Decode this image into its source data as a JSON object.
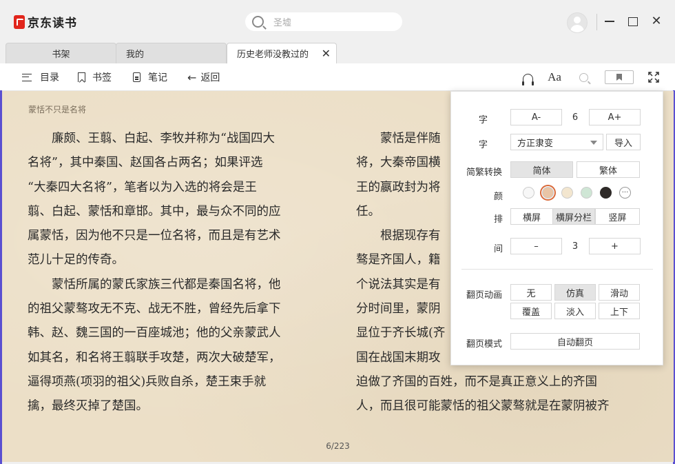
{
  "app": {
    "logo_text": "京东读书"
  },
  "search": {
    "placeholder": "圣墟"
  },
  "tabs": [
    {
      "label": "书架"
    },
    {
      "label": "我的"
    },
    {
      "label": "历史老师没教过的"
    }
  ],
  "toolbar": {
    "toc_label": "目录",
    "bookmark_label": "书签",
    "notes_label": "笔记",
    "back_label": "返回",
    "font_icon_text": "Aa"
  },
  "book": {
    "running_head": "蒙恬不只是名将",
    "left_column": [
      "　　廉颇、王翦、白起、李牧并称为“战国四大",
      "名将”，其中秦国、赵国各占两名；如果评选",
      "“大秦四大名将”，笔者以为入选的将会是王",
      "翦、白起、蒙恬和章邯。其中，最与众不同的应",
      "属蒙恬，因为他不只是一位名将，而且是有艺术",
      "范儿十足的传奇。",
      "　　蒙恬所属的蒙氏家族三代都是秦国名将，他",
      "的祖父蒙骜攻无不克、战无不胜，曾经先后拿下",
      "韩、赵、魏三国的一百座城池；他的父亲蒙武人",
      "如其名，和名将王翦联手攻楚，两次大破楚军，",
      "逼得项燕(项羽的祖父)兵败自杀，楚王束手就",
      "擒，最终灭掉了楚国。"
    ],
    "right_column": [
      "　　蒙恬是伴随",
      "将，大秦帝国横",
      "王的嬴政封为将",
      "任。",
      "　　根据现存有",
      "骜是齐国人，籍",
      "个说法其实是有",
      "分时间里，蒙阴",
      "显位于齐长城(齐",
      "国在战国末期攻",
      "迫做了齐国的百姓，而不是真正意义上的齐国",
      "人，而且很可能蒙恬的祖父蒙骜就是在蒙阴被齐"
    ],
    "page_indicator": "6/223"
  },
  "settings": {
    "font_size": {
      "label": "字",
      "decrease": "A-",
      "value": "6",
      "increase": "A+"
    },
    "font_face": {
      "label": "字",
      "selected": "方正隶变",
      "import_label": "导入"
    },
    "conversion": {
      "label": "简繁转换",
      "options": [
        "简体",
        "繁体"
      ],
      "selected": "简体"
    },
    "color": {
      "label": "颜",
      "swatches": [
        "#f7f7f7",
        "#e9c5a6",
        "#f3e6cf",
        "#cfe6d5",
        "#2e2a28"
      ],
      "selected_index": 1,
      "more_label": "···"
    },
    "layout": {
      "label": "排",
      "options": [
        "横屏",
        "横屏分栏",
        "竖屏"
      ],
      "selected": "横屏分栏"
    },
    "spacing": {
      "label": "间",
      "decrease": "–",
      "value": "3",
      "increase": "+"
    },
    "page_anim": {
      "label": "翻页动画",
      "options": [
        "无",
        "仿真",
        "滑动",
        "覆盖",
        "淡入",
        "上下"
      ],
      "selected": "仿真"
    },
    "page_mode": {
      "label": "翻页模式",
      "value": "自动翻页"
    }
  }
}
